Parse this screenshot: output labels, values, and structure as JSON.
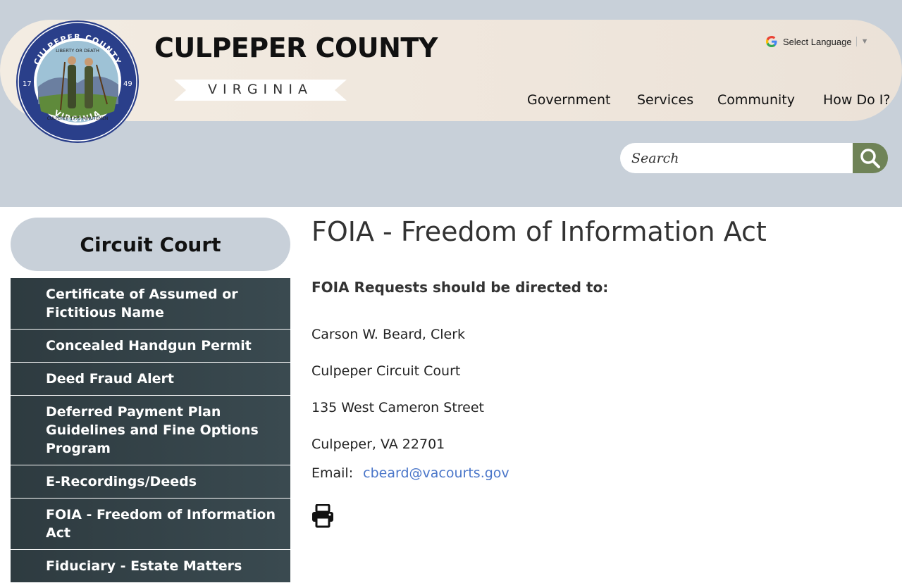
{
  "header": {
    "county_title": "CULPEPER COUNTY",
    "state": "VIRGINIA",
    "seal_text": {
      "top": "CULPEPER COUNTY",
      "motto": "LIBERTY OR DEATH",
      "left_year": "17",
      "right_year": "49",
      "bottom": "VIRGINIA",
      "ribbon": "CULPEPER 1775 MINUTEMEN"
    },
    "translate_label": "Select Language",
    "translate_arrow": "▼"
  },
  "nav": {
    "items": [
      {
        "label": "Government"
      },
      {
        "label": "Services"
      },
      {
        "label": "Community"
      },
      {
        "label": "How Do I?"
      }
    ]
  },
  "search": {
    "placeholder": "Search",
    "button_icon": "search-icon",
    "button_color": "#6f8357"
  },
  "sidebar": {
    "title": "Circuit Court",
    "items": [
      {
        "label": "Certificate of Assumed or Fictitious Name"
      },
      {
        "label": "Concealed Handgun Permit"
      },
      {
        "label": "Deed Fraud Alert"
      },
      {
        "label": "Deferred Payment Plan Guidelines and Fine Options Program"
      },
      {
        "label": "E-Recordings/Deeds"
      },
      {
        "label": "FOIA - Freedom of Information Act"
      },
      {
        "label": "Fiduciary - Estate Matters"
      }
    ]
  },
  "main": {
    "title": "FOIA - Freedom of Information Act",
    "subhead": "FOIA Requests should be directed to:",
    "address_lines": [
      "Carson W. Beard, Clerk",
      "Culpeper Circuit Court",
      "135 West Cameron Street",
      "Culpeper, VA 22701"
    ],
    "email_label": "Email:",
    "email": "cbeard@vacourts.gov",
    "print_icon": "print-icon"
  },
  "colors": {
    "header_bg": "#c8d0d9",
    "banner_bg": "#f0e8de",
    "sidebar_item_bg": "#34434a",
    "link": "#4a76c9",
    "accent_green": "#6f8357"
  }
}
